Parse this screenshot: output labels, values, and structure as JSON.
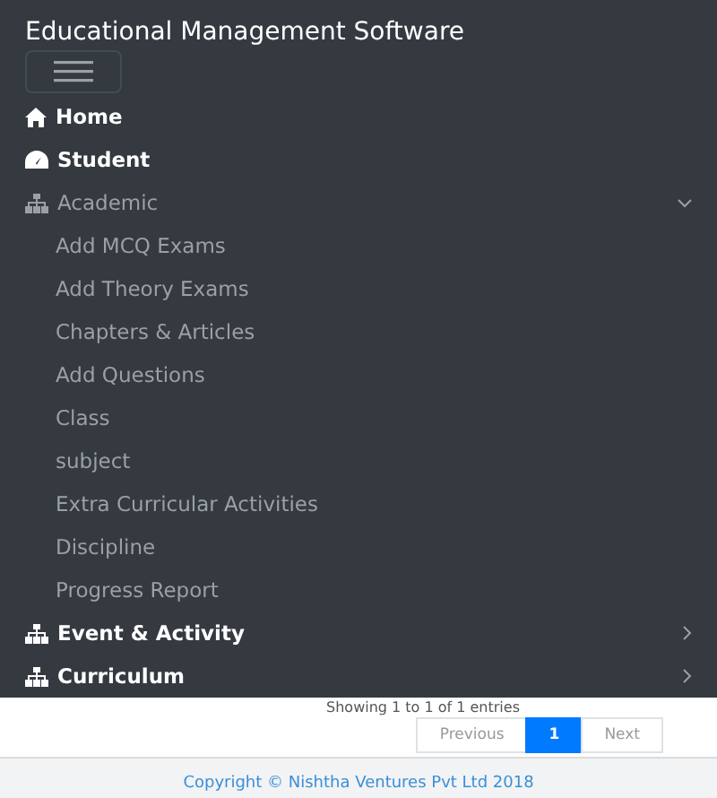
{
  "brand": "Educational Management Software",
  "menu": [
    {
      "label": "Home",
      "kind": "home"
    },
    {
      "label": "Student",
      "kind": "gauge"
    },
    {
      "label": "Academic",
      "kind": "sitemap",
      "expanded": true,
      "children": [
        {
          "label": "Add MCQ Exams"
        },
        {
          "label": "Add Theory Exams"
        },
        {
          "label": "Chapters & Articles"
        },
        {
          "label": "Add Questions"
        },
        {
          "label": "Class"
        },
        {
          "label": "subject"
        },
        {
          "label": "Extra Curricular Activities"
        },
        {
          "label": "Discipline"
        },
        {
          "label": "Progress Report"
        }
      ]
    },
    {
      "label": "Event & Activity",
      "kind": "sitemap",
      "expanded": false
    },
    {
      "label": "Curriculum",
      "kind": "sitemap",
      "expanded": false
    }
  ],
  "table_info": "Showing 1 to 1 of 1 entries",
  "pagination": [
    {
      "label": "Previous",
      "selected": false,
      "disabled": true
    },
    {
      "label": "1",
      "selected": true,
      "disabled": false
    },
    {
      "label": "Next",
      "selected": false,
      "disabled": true
    }
  ],
  "footer": "Copyright © Nishtha Ventures Pvt Ltd 2018"
}
